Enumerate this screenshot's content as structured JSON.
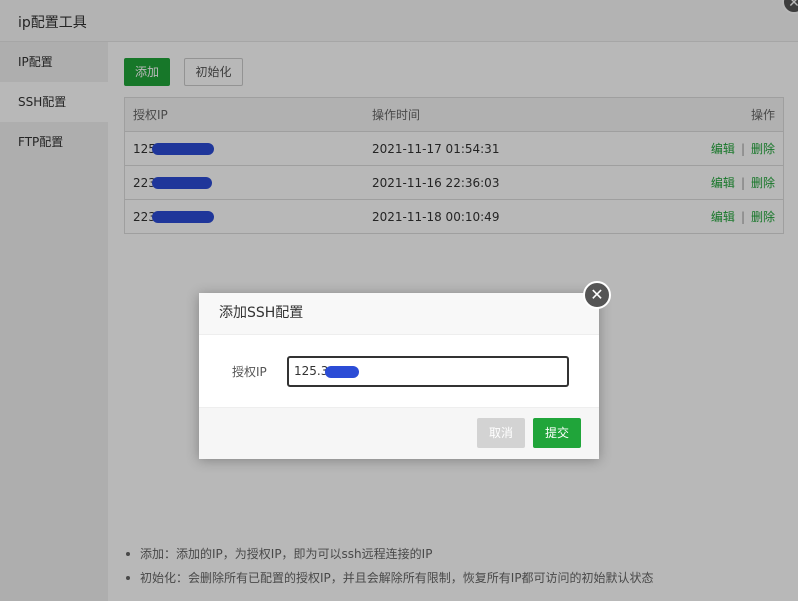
{
  "window": {
    "title": "ip配置工具",
    "close_glyph": "✕"
  },
  "sidebar": {
    "items": [
      {
        "label": "IP配置"
      },
      {
        "label": "SSH配置"
      },
      {
        "label": "FTP配置"
      }
    ]
  },
  "toolbar": {
    "add_label": "添加",
    "init_label": "初始化"
  },
  "table": {
    "headers": {
      "ip": "授权IP",
      "time": "操作时间",
      "actions": "操作"
    },
    "rows": [
      {
        "ip": "125",
        "time": "2021-11-17 01:54:31",
        "edit": "编辑",
        "delete": "删除"
      },
      {
        "ip": "223",
        "time": "2021-11-16 22:36:03",
        "edit": "编辑",
        "delete": "删除"
      },
      {
        "ip": "223",
        "time": "2021-11-18 00:10:49",
        "edit": "编辑",
        "delete": "删除"
      }
    ],
    "separator": "|"
  },
  "notes": [
    "添加：添加的IP，为授权IP，即为可以ssh远程连接的IP",
    "初始化：会删除所有已配置的授权IP，并且会解除所有限制，恢复所有IP都可访问的初始默认状态"
  ],
  "dialog": {
    "title": "添加SSH配置",
    "close_glyph": "✕",
    "field_label": "授权IP",
    "field_value": "125.3",
    "cancel_label": "取消",
    "submit_label": "提交"
  },
  "colors": {
    "accent": "#20a53a",
    "redaction": "#2b4cd6"
  }
}
